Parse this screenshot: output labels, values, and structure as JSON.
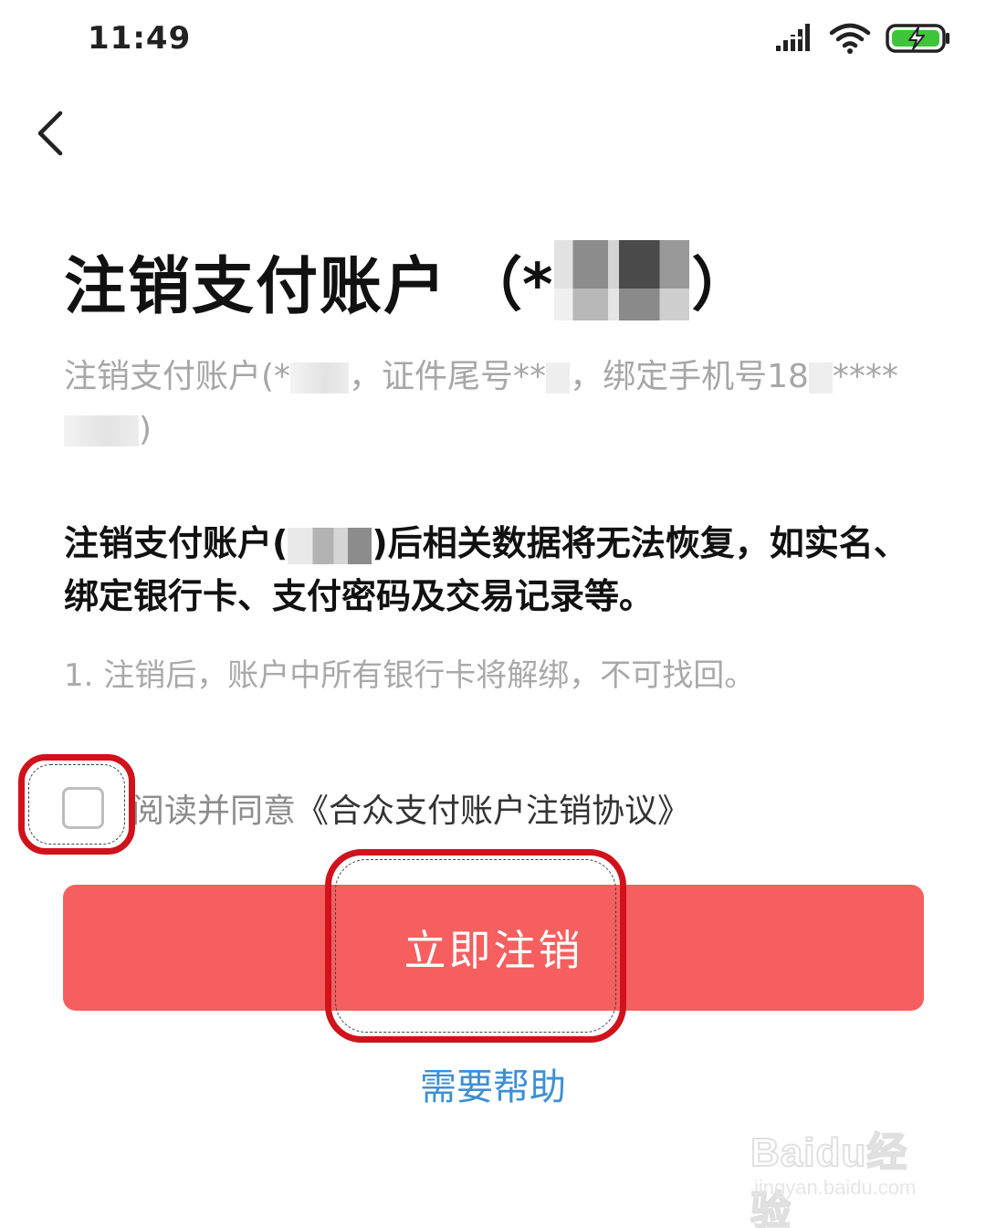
{
  "status_bar": {
    "time": "11:49",
    "icons": [
      "signal-icon",
      "wifi-icon",
      "battery-charging-icon"
    ]
  },
  "nav": {
    "back_icon": "chevron-left-icon"
  },
  "page": {
    "title": "注销支付账户",
    "title_account_prefix": "（*",
    "title_account_suffix": "）",
    "subtitle_part1": "注销支付账户(*",
    "subtitle_part2": "，证件尾号**",
    "subtitle_part3": "，绑定手机号18",
    "subtitle_part4": "****",
    "subtitle_part5": ")",
    "warning_part1": "注销支付账户(",
    "warning_part2": ")后相关数据将无法恢复，如实名、绑定银行卡、支付密码及交易记录等。",
    "note": "1. 注销后，账户中所有银行卡将解绑，不可找回。"
  },
  "agreement": {
    "checked": false,
    "prefix": "阅读并同意",
    "link_label": "《合众支付账户注销协议》"
  },
  "actions": {
    "submit_label": "立即注销",
    "help_label": "需要帮助"
  },
  "colors": {
    "submit_bg": "#f65f5f",
    "help_link": "#3d8fd6",
    "annotation_red": "#d0121c"
  },
  "watermark": {
    "logo": "Baidu经验",
    "url": "jingyan.baidu.com"
  }
}
